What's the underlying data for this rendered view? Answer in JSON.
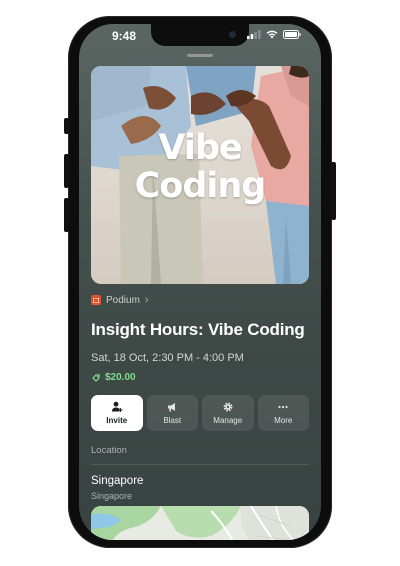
{
  "status_bar": {
    "time": "9:48"
  },
  "cover": {
    "line1": "Vibe",
    "line2": "Coding"
  },
  "organizer": {
    "name": "Podium",
    "chevron": "›"
  },
  "event": {
    "title": "Insight Hours: Vibe Coding",
    "datetime": "Sat, 18 Oct, 2:30 PM - 4:00 PM",
    "price": "$20.00"
  },
  "actions": [
    {
      "label": "Invite",
      "icon": "person-add-icon"
    },
    {
      "label": "Blast",
      "icon": "megaphone-icon"
    },
    {
      "label": "Manage",
      "icon": "gear-icon"
    },
    {
      "label": "More",
      "icon": "ellipsis-icon"
    }
  ],
  "location": {
    "section_label": "Location",
    "name": "Singapore",
    "sub": "Singapore"
  },
  "colors": {
    "accent_green": "#7ee08a",
    "organizer_logo": "#e0532c"
  }
}
